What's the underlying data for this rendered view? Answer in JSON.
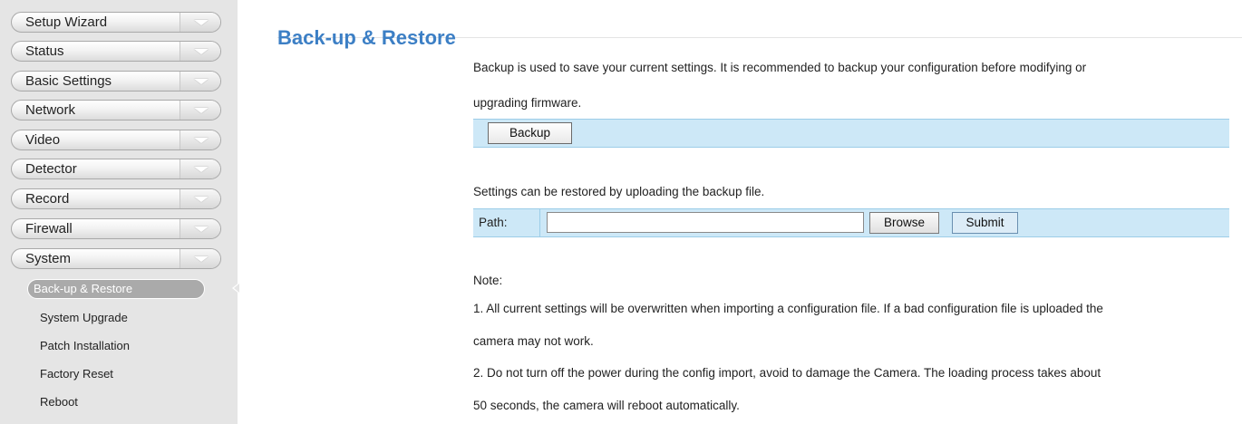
{
  "sidebar": {
    "menu": [
      {
        "label": "Setup Wizard"
      },
      {
        "label": "Status"
      },
      {
        "label": "Basic Settings"
      },
      {
        "label": "Network"
      },
      {
        "label": "Video"
      },
      {
        "label": "Detector"
      },
      {
        "label": "Record"
      },
      {
        "label": "Firewall"
      },
      {
        "label": "System"
      }
    ],
    "submenu": [
      {
        "label": "Back-up & Restore",
        "active": true
      },
      {
        "label": "System Upgrade"
      },
      {
        "label": "Patch Installation"
      },
      {
        "label": "Factory Reset"
      },
      {
        "label": "Reboot"
      }
    ]
  },
  "page": {
    "title": "Back-up & Restore",
    "backup_desc_1": "Backup is used to save your current settings. It is recommended to backup your configuration before modifying or",
    "backup_desc_2": "upgrading firmware.",
    "backup_button": "Backup",
    "restore_desc": "Settings can be restored by uploading the backup file.",
    "path_label": "Path:",
    "path_value": "",
    "browse_button": "Browse",
    "submit_button": "Submit",
    "note_title": "Note:",
    "note_1a": "1. All current settings will be overwritten when importing a configuration file. If a bad configuration file is uploaded the",
    "note_1b": "camera may not work.",
    "note_2a": "2. Do not turn off the power during the config import, avoid to damage the Camera. The loading process takes about",
    "note_2b": "50 seconds, the camera will reboot automatically."
  },
  "colors": {
    "title": "#3c7fc5",
    "panel_bg": "#cde8f7",
    "sidebar_bg": "#e5e5e5"
  }
}
